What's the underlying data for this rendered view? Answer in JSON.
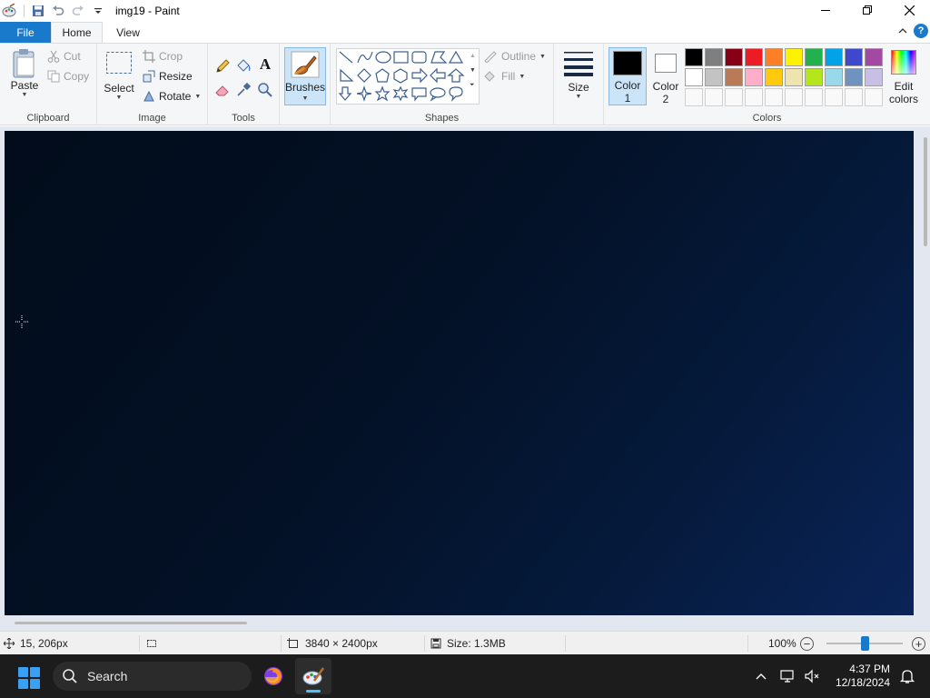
{
  "window": {
    "title": "img19 - Paint",
    "controls": [
      "minimize",
      "maximize",
      "close"
    ]
  },
  "quick_access": [
    "save-icon",
    "undo-icon",
    "redo-icon",
    "customize-icon"
  ],
  "tabs": {
    "file": "File",
    "home": "Home",
    "view": "View"
  },
  "ribbon": {
    "clipboard": {
      "label": "Clipboard",
      "paste": "Paste",
      "cut": "Cut",
      "copy": "Copy"
    },
    "image": {
      "label": "Image",
      "select": "Select",
      "crop": "Crop",
      "resize": "Resize",
      "rotate": "Rotate"
    },
    "tools": {
      "label": "Tools"
    },
    "brushes": {
      "label": "Brushes"
    },
    "shapes": {
      "label": "Shapes",
      "outline": "Outline",
      "fill": "Fill"
    },
    "size": {
      "label": "Size"
    },
    "colors": {
      "label": "Colors",
      "color1_line1": "Color",
      "color1_line2": "1",
      "color2_line1": "Color",
      "color2_line2": "2",
      "edit_line1": "Edit",
      "edit_line2": "colors",
      "color1_value": "#000000",
      "color2_value": "#ffffff",
      "palette_row1": [
        "#000000",
        "#7f7f7f",
        "#880015",
        "#ed1c24",
        "#ff7f27",
        "#fff200",
        "#22b14c",
        "#00a2e8",
        "#3f48cc",
        "#a349a4"
      ],
      "palette_row2": [
        "#ffffff",
        "#c3c3c3",
        "#b97a57",
        "#ffaec9",
        "#ffc90e",
        "#efe4b0",
        "#b5e61d",
        "#99d9ea",
        "#7092be",
        "#c8bfe7"
      ]
    }
  },
  "status": {
    "cursor_pos": "15, 206px",
    "image_size": "3840 × 2400px",
    "file_size": "Size: 1.3MB",
    "zoom": "100%",
    "zoom_value": 0.5
  },
  "taskbar": {
    "search_placeholder": "Search",
    "time": "4:37 PM",
    "date": "12/18/2024"
  }
}
